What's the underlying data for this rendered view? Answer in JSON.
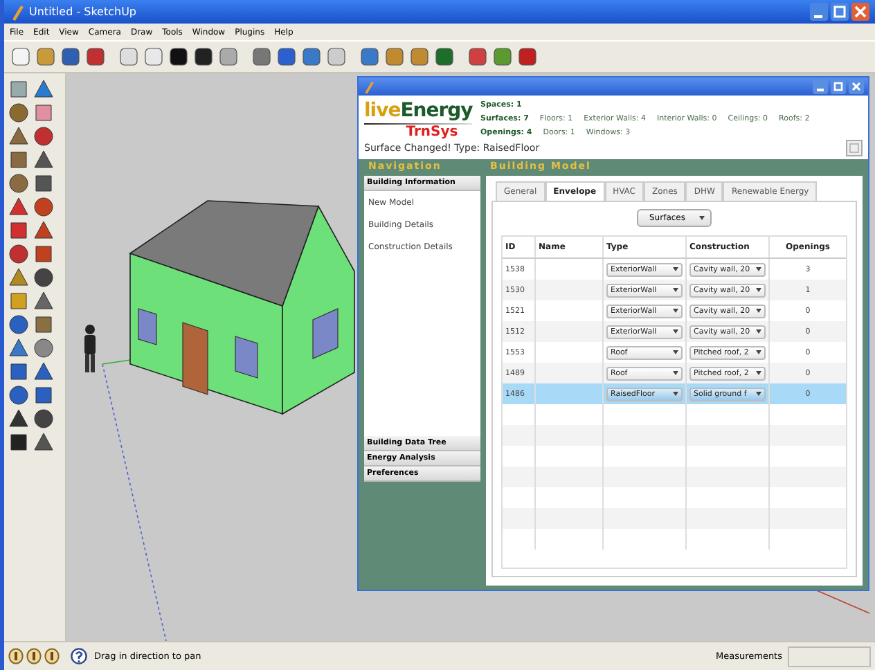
{
  "window": {
    "title": "Untitled - SketchUp"
  },
  "menu": [
    "File",
    "Edit",
    "View",
    "Camera",
    "Draw",
    "Tools",
    "Window",
    "Plugins",
    "Help"
  ],
  "plugin": {
    "logo": {
      "word_1": "live",
      "word_2": "Energy",
      "subtitle": "TrnSys"
    },
    "summary": [
      {
        "label": "Spaces: 1"
      },
      {
        "label": "Surfaces: 7",
        "items": [
          "Floors: 1",
          "Exterior Walls: 4",
          "Interior Walls: 0",
          "Ceilings: 0",
          "Roofs: 2"
        ]
      },
      {
        "label": "Openings: 4",
        "items": [
          "Doors: 1",
          "Windows: 3"
        ]
      }
    ],
    "message": "Surface Changed! Type: RaisedFloor",
    "navigation": {
      "title": "Navigation",
      "sections": [
        {
          "title": "Building Information",
          "items": [
            "New Model",
            "Building Details",
            "Construction Details"
          ]
        },
        {
          "title": "Building Data Tree"
        },
        {
          "title": "Energy Analysis"
        },
        {
          "title": "Preferences"
        }
      ]
    },
    "building_model": {
      "title": "Building Model",
      "tabs": [
        {
          "label": "General",
          "selected": false
        },
        {
          "label": "Envelope",
          "selected": true
        },
        {
          "label": "HVAC",
          "selected": false
        },
        {
          "label": "Zones",
          "selected": false
        },
        {
          "label": "DHW",
          "selected": false
        },
        {
          "label": "Renewable Energy",
          "selected": false
        }
      ],
      "dropdown": "Surfaces",
      "columns": [
        "ID",
        "Name",
        "Type",
        "Construction",
        "Openings"
      ],
      "rows": [
        {
          "id": "1538",
          "type": "ExteriorWall",
          "construction": "Cavity wall, 20",
          "openings": "3",
          "selected": false
        },
        {
          "id": "1530",
          "type": "ExteriorWall",
          "construction": "Cavity wall, 20",
          "openings": "1",
          "selected": false
        },
        {
          "id": "1521",
          "type": "ExteriorWall",
          "construction": "Cavity wall, 20",
          "openings": "0",
          "selected": false
        },
        {
          "id": "1512",
          "type": "ExteriorWall",
          "construction": "Cavity wall, 20",
          "openings": "0",
          "selected": false
        },
        {
          "id": "1553",
          "type": "Roof",
          "construction": "Pitched roof, 2",
          "openings": "0",
          "selected": false
        },
        {
          "id": "1489",
          "type": "Roof",
          "construction": "Pitched roof, 2",
          "openings": "0",
          "selected": false
        },
        {
          "id": "1486",
          "type": "RaisedFloor",
          "construction": "Solid ground f",
          "openings": "0",
          "selected": true
        }
      ]
    }
  },
  "status_bar": {
    "hint": "Drag in direction to pan",
    "measurements_label": "Measurements"
  }
}
